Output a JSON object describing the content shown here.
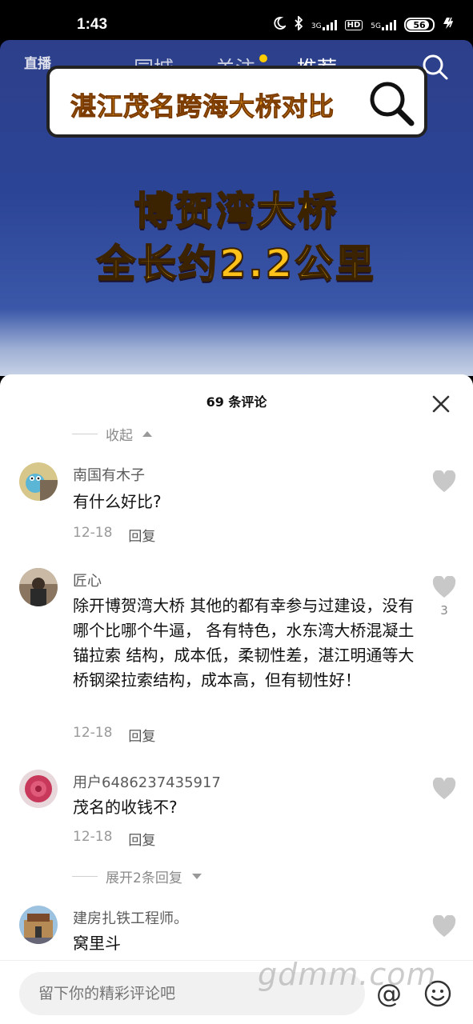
{
  "status": {
    "time": "1:43",
    "battery": "56",
    "sig1": "3G",
    "sig2": "5G",
    "hd": "HD"
  },
  "topnav": {
    "live": "直播",
    "tabs": [
      "同城",
      "关注",
      "推荐"
    ],
    "active_tab": "推荐"
  },
  "video": {
    "banner": "湛江茂名跨海大桥对比",
    "line1": "博贺湾大桥",
    "line2": "全长约2.2公里"
  },
  "comments_panel": {
    "title": "69 条评论",
    "collapse_label": "收起",
    "expand_label": "展开2条回复",
    "comments": [
      {
        "user": "南国有木子",
        "text": "有什么好比?",
        "date": "12-18",
        "reply": "回复",
        "likes": ""
      },
      {
        "user": "匠心",
        "text": "除开博贺湾大桥 其他的都有幸参与过建设，没有哪个比哪个牛逼， 各有特色，水东湾大桥混凝土锚拉索 结构，成本低，柔韧性差，湛江明通等大桥钢梁拉索结构，成本高，但有韧性好！",
        "date": "12-18",
        "reply": "回复",
        "likes": "3"
      },
      {
        "user": "用户6486237435917",
        "text": "茂名的收钱不?",
        "date": "12-18",
        "reply": "回复",
        "likes": ""
      },
      {
        "user": "建房扎铁工程师。",
        "text": "窝里斗",
        "date": "",
        "reply": "",
        "likes": ""
      }
    ]
  },
  "input_bar": {
    "placeholder": "留下你的精彩评论吧",
    "at": "@"
  },
  "watermark": "gdmm.com",
  "colors": {
    "accent_yellow": "#ffc21a",
    "video_bg": "#2c4496",
    "dot": "#ffcc00"
  }
}
